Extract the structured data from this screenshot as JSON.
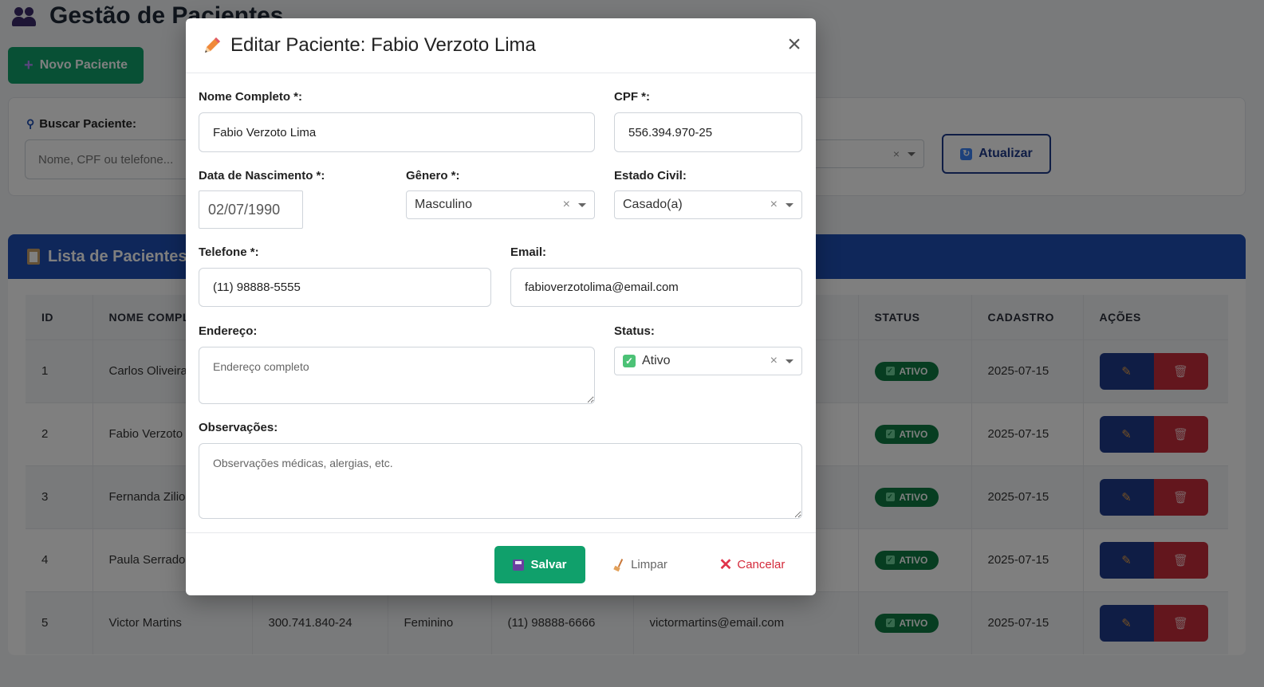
{
  "page": {
    "title": "Gestão de Pacientes",
    "new_patient_label": "Novo Paciente",
    "search_label": "Buscar Paciente:",
    "search_placeholder": "Nome, CPF ou telefone...",
    "refresh_label": "Atualizar",
    "list_title": "Lista de Pacientes"
  },
  "table": {
    "columns": [
      "ID",
      "NOME COMPLETO",
      "",
      "",
      "",
      "",
      "STATUS",
      "CADASTRO",
      "AÇÕES"
    ],
    "rows": [
      {
        "id": "1",
        "name": "Carlos Oliveira",
        "cpf": "",
        "gender": "",
        "phone": "",
        "email": "",
        "status": "ATIVO",
        "date": "2025-07-15"
      },
      {
        "id": "2",
        "name": "Fabio Verzoto Lima",
        "cpf": "",
        "gender": "",
        "phone": "",
        "email": "",
        "status": "ATIVO",
        "date": "2025-07-15"
      },
      {
        "id": "3",
        "name": "Fernanda Zilio",
        "cpf": "",
        "gender": "",
        "phone": "",
        "email": "",
        "status": "ATIVO",
        "date": "2025-07-15"
      },
      {
        "id": "4",
        "name": "Paula Serrado",
        "cpf": "",
        "gender": "",
        "phone": "",
        "email": "",
        "status": "ATIVO",
        "date": "2025-07-15"
      },
      {
        "id": "5",
        "name": "Victor Martins",
        "cpf": "300.741.840-24",
        "gender": "Feminino",
        "phone": "(11) 98888-6666",
        "email": "victormartins@email.com",
        "status": "ATIVO",
        "date": "2025-07-15"
      }
    ]
  },
  "modal": {
    "title": "Editar Paciente: Fabio Verzoto Lima",
    "close_label": "×",
    "fields": {
      "nome_label": "Nome Completo *:",
      "nome_value": "Fabio Verzoto Lima",
      "cpf_label": "CPF *:",
      "cpf_value": "556.394.970-25",
      "nascimento_label": "Data de Nascimento *:",
      "nascimento_value": "02/07/1990",
      "genero_label": "Gênero *:",
      "genero_value": "Masculino",
      "estado_civil_label": "Estado Civil:",
      "estado_civil_value": "Casado(a)",
      "telefone_label": "Telefone *:",
      "telefone_value": "(11) 98888-5555",
      "email_label": "Email:",
      "email_value": "fabioverzotolima@email.com",
      "endereco_label": "Endereço:",
      "endereco_placeholder": "Endereço completo",
      "status_label": "Status:",
      "status_value": "Ativo",
      "observacoes_label": "Observações:",
      "observacoes_placeholder": "Observações médicas, alergias, etc."
    },
    "buttons": {
      "save": "Salvar",
      "clear": "Limpar",
      "cancel": "Cancelar"
    }
  },
  "colors": {
    "primary": "#1e3a8a",
    "success": "#10a06b",
    "danger": "#c62d3a",
    "header_blue": "#1e4fb5"
  },
  "icons": [
    "users-icon",
    "plus-icon",
    "search-icon",
    "refresh-icon",
    "clipboard-icon",
    "pencil-icon",
    "trash-icon",
    "check-icon",
    "floppy-icon",
    "broom-icon",
    "x-icon",
    "close-icon"
  ]
}
